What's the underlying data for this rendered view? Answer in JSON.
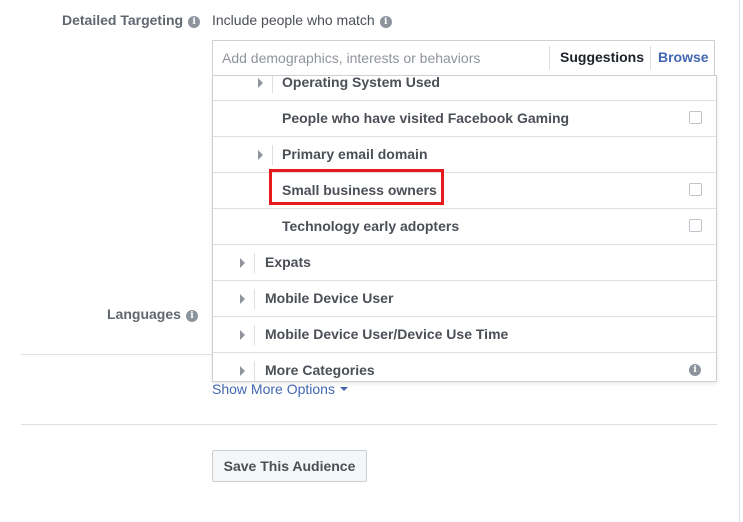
{
  "targeting": {
    "label": "Detailed Targeting",
    "include_label": "Include people who match",
    "search": {
      "placeholder": "Add demographics, interests or behaviors",
      "value": ""
    },
    "suggestions_label": "Suggestions",
    "browse_label": "Browse"
  },
  "dropdown": {
    "items": [
      {
        "label": "Operating System Used",
        "indent": 1,
        "expandable": true,
        "control": "none"
      },
      {
        "label": "People who have visited Facebook Gaming",
        "indent": 1,
        "expandable": false,
        "control": "checkbox",
        "checked": false
      },
      {
        "label": "Primary email domain",
        "indent": 1,
        "expandable": true,
        "control": "none"
      },
      {
        "label": "Small business owners",
        "indent": 1,
        "expandable": false,
        "control": "checkbox",
        "checked": false,
        "highlighted": true
      },
      {
        "label": "Technology early adopters",
        "indent": 1,
        "expandable": false,
        "control": "checkbox",
        "checked": false
      },
      {
        "label": "Expats",
        "indent": 0,
        "expandable": true,
        "control": "none"
      },
      {
        "label": "Mobile Device User",
        "indent": 0,
        "expandable": true,
        "control": "none"
      },
      {
        "label": "Mobile Device User/Device Use Time",
        "indent": 0,
        "expandable": true,
        "control": "none"
      },
      {
        "label": "More Categories",
        "indent": 0,
        "expandable": true,
        "control": "info"
      }
    ]
  },
  "languages": {
    "label": "Languages"
  },
  "show_more_label": "Show More Options",
  "save_button_label": "Save This Audience",
  "colors": {
    "link": "#4267b2",
    "highlight": "#e8191d",
    "border": "#ccd0d5"
  }
}
